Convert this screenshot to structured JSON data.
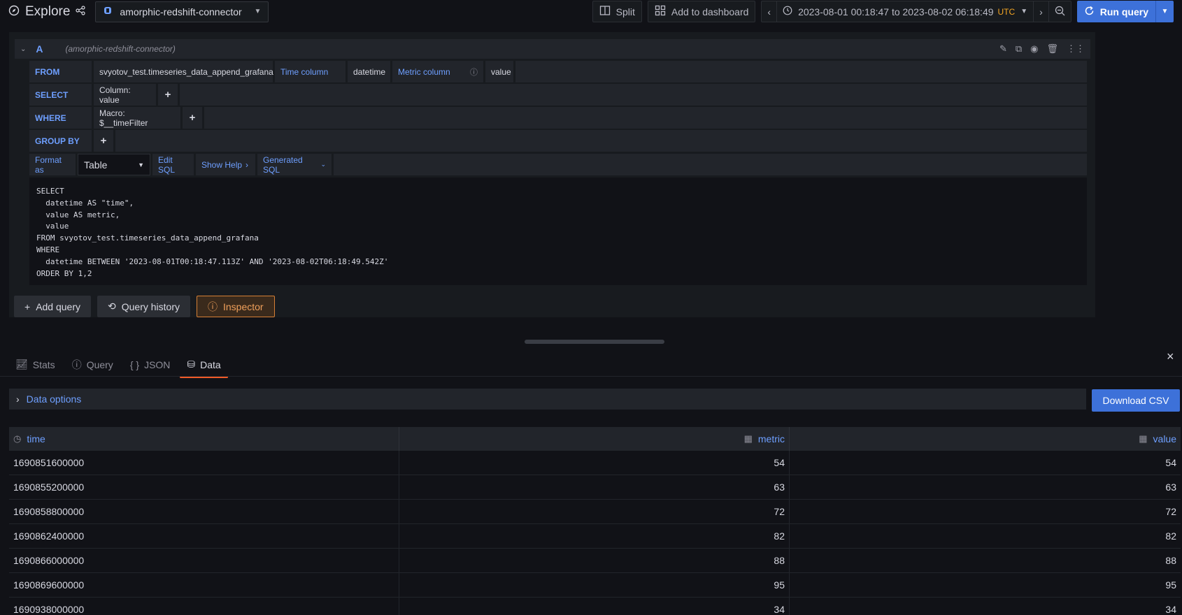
{
  "topbar": {
    "title": "Explore",
    "datasource": "amorphic-redshift-connector",
    "split_label": "Split",
    "add_dashboard_label": "Add to dashboard",
    "time_range": "2023-08-01 00:18:47 to 2023-08-02 06:18:49",
    "timezone": "UTC",
    "run_query_label": "Run query"
  },
  "query": {
    "ref_id": "A",
    "datasource_hint": "(amorphic-redshift-connector)",
    "from_label": "FROM",
    "table_name": "svyotov_test.timeseries_data_append_grafana",
    "time_column_label": "Time column",
    "time_column_value": "datetime",
    "metric_column_label": "Metric column",
    "metric_column_value": "value",
    "select_label": "SELECT",
    "select_value": "Column: value",
    "where_label": "WHERE",
    "where_value": "Macro: $__timeFilter",
    "group_by_label": "GROUP BY",
    "format_as_label": "Format as",
    "format_as_value": "Table",
    "edit_sql_label": "Edit SQL",
    "show_help_label": "Show Help",
    "generated_sql_label": "Generated SQL",
    "sql_text": "SELECT\n  datetime AS \"time\",\n  value AS metric,\n  value\nFROM svyotov_test.timeseries_data_append_grafana\nWHERE\n  datetime BETWEEN '2023-08-01T00:18:47.113Z' AND '2023-08-02T06:18:49.542Z'\nORDER BY 1,2"
  },
  "actions": {
    "add_query": "Add query",
    "query_history": "Query history",
    "inspector": "Inspector"
  },
  "inspector": {
    "tabs": [
      "Stats",
      "Query",
      "JSON",
      "Data"
    ],
    "active_tab": "Data",
    "data_options_label": "Data options",
    "download_csv_label": "Download CSV",
    "columns": [
      "time",
      "metric",
      "value"
    ],
    "rows": [
      [
        "1690851600000",
        "54",
        "54"
      ],
      [
        "1690855200000",
        "63",
        "63"
      ],
      [
        "1690858800000",
        "72",
        "72"
      ],
      [
        "1690862400000",
        "82",
        "82"
      ],
      [
        "1690866000000",
        "88",
        "88"
      ],
      [
        "1690869600000",
        "95",
        "95"
      ],
      [
        "1690938000000",
        "34",
        "34"
      ]
    ]
  },
  "colors": {
    "accent": "#3d71d9",
    "keyword": "#6e9fff",
    "inspector_orange": "#f0a05b",
    "active_tab_underline": "#f05a28"
  }
}
